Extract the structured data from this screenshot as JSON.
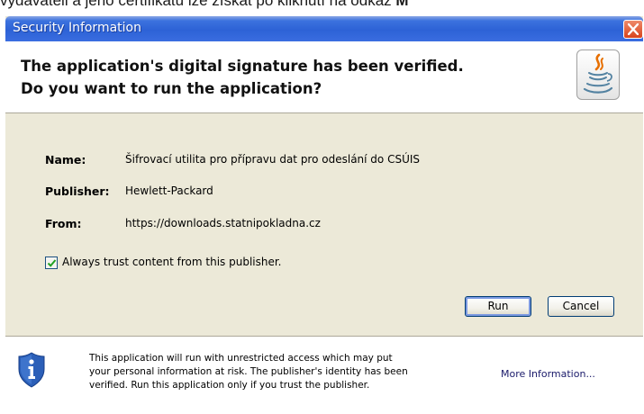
{
  "page": {
    "background_text_prefix": "vydavateli a jeho certifikátu lze získat po kliknutí na odkaz ",
    "background_text_bold": "M"
  },
  "dialog": {
    "title": "Security Information",
    "header_line1": "The application's digital signature has been verified.",
    "header_line2": "Do you want to run the application?",
    "fields": [
      {
        "label": "Name:",
        "value": "Šifrovací utilita pro přípravu dat pro odeslání do CSÚIS"
      },
      {
        "label": "Publisher:",
        "value": "Hewlett-Packard"
      },
      {
        "label": "From:",
        "value": "https://downloads.statnipokladna.cz"
      }
    ],
    "checkbox_label": "Always trust content from this publisher.",
    "checkbox_checked": true,
    "run_label": "Run",
    "cancel_label": "Cancel",
    "footer_line1": "This application will run with unrestricted access which may put",
    "footer_line2": "your personal information at risk. The publisher's identity has been",
    "footer_line3": "verified. Run this application only if you trust the publisher.",
    "more_info_label": "More Information...",
    "icons": {
      "logo": "java-logo-icon",
      "close": "close-icon",
      "checkbox": "checkmark-icon",
      "security": "shield-info-icon"
    },
    "colors": {
      "titlebar": "#2d62d6",
      "close_button": "#d8431c",
      "dialog_body": "#ece9d8"
    }
  }
}
